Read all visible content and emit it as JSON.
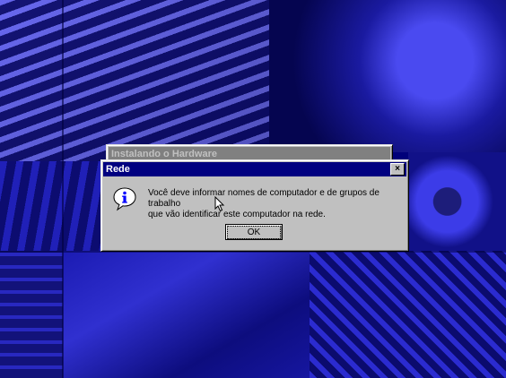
{
  "parent_window": {
    "title": "Instalando o Hardware"
  },
  "dialog": {
    "title": "Rede",
    "close_glyph": "×",
    "message_line1": "Você deve informar nomes de computador e de grupos de trabalho",
    "message_line2": "que vão identificar este computador na rede.",
    "ok_label": "OK",
    "icon": "info-icon"
  },
  "colors": {
    "desktop": "#00007a",
    "active_title": "#000080",
    "inactive_title": "#808080",
    "face": "#c0c0c0"
  }
}
